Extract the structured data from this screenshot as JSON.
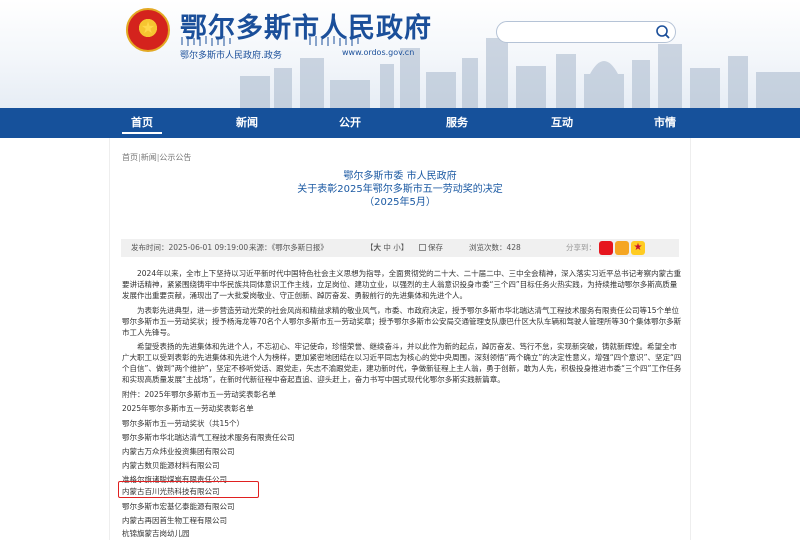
{
  "header": {
    "title": "鄂尔多斯市人民政府",
    "subtitle": "鄂尔多斯市人民政府.政务",
    "url": "www.ordos.gov.cn",
    "search_placeholder": ""
  },
  "nav": {
    "items": [
      "首页",
      "新闻",
      "公开",
      "服务",
      "互动",
      "市情"
    ],
    "active_index": 0
  },
  "breadcrumb": [
    "首页",
    "新闻",
    "公示公告"
  ],
  "article": {
    "title_line1": "鄂尔多斯市委 市人民政府",
    "title_line2": "关于表彰2025年鄂尔多斯市五一劳动奖的决定",
    "title_line3": "（2025年5月）",
    "meta": {
      "publish_time": "发布时间：2025-06-01 09:19:00",
      "source": "来源：《鄂尔多斯日报》",
      "size_large": "大",
      "size_mid": "中",
      "size_small": "小",
      "save": "保存",
      "views": "浏览次数：428",
      "share_label": "分享到："
    },
    "paragraphs": [
      "2024年以来，全市上下坚持以习近平新时代中国特色社会主义思想为指导，全面贯彻党的二十大、二十届二中、三中全会精神，深入落实习近平总书记考察内蒙古重要讲话精神，紧紧围绕铸牢中华民族共同体意识工作主线，立足岗位、建功立业，以强烈的主人翁意识投身市委“三个四”目标任务火热实践，为持续推动鄂尔多斯高质量发展作出重要贡献，涌现出了一大批爱岗敬业、守正创新、踔厉奋发、勇毅前行的先进集体和先进个人。",
      "为表彰先进典型，进一步营造劳动光荣的社会风尚和精益求精的敬业风气，市委、市政府决定，授予鄂尔多斯市华北瑞达清气工程技术服务有限责任公司等15个单位鄂尔多斯市五一劳动奖状；授予杨海龙等70名个人鄂尔多斯市五一劳动奖章；授予鄂尔多斯市公安局交通管理支队康巴什区大队车辆和驾驶人管理所等30个集体鄂尔多斯市工人先锋号。",
      "希望受表扬的先进集体和先进个人，不忘初心、牢记使命，珍惜荣誉、继续奋斗，并以此作为新的起点，踔厉奋发、笃行不怠，实现新突破，铸就新辉煌。希望全市广大职工以受到表彰的先进集体和先进个人为榜样，更加紧密地团结在以习近平同志为核心的党中央周围，深刻领悟“两个确立”的决定性意义，增强“四个意识”、坚定“四个自信”、做到“两个维护”，坚定不移听党话、跟党走，矢志不渝跟党走，建功新时代，争做新征程上主人翁，勇于创新，敢为人先，积极投身推进市委“三个四”工作任务和实现高质量发展“主战场”，在新时代新征程中奋起直追、迎头赶上，奋力书写中国式现代化鄂尔多斯实践新篇章。"
    ],
    "list": [
      "附件：2025年鄂尔多斯市五一劳动奖表彰名单",
      "2025年鄂尔多斯市五一劳动奖表彰名单",
      "鄂尔多斯市五一劳动奖状（共15个）",
      "鄂尔多斯市华北瑞达清气工程技术服务有限责任公司",
      "内蒙古万众炜业投资集团有限公司",
      "内蒙古数贝能源材料有限公司",
      "准格尔旗诸聪煤炭有限责任公司",
      "内蒙古百川光热科技有限公司",
      "鄂尔多斯市宏基亿泰能源有限公司",
      "内蒙古再因首生物工程有限公司",
      "杭锦旗蒙吉岗幼儿园"
    ],
    "highlighted_index": 7
  },
  "colors": {
    "brand_blue": "#16519b",
    "title_blue": "#1c5aa3",
    "highlight_red": "#e02020"
  }
}
